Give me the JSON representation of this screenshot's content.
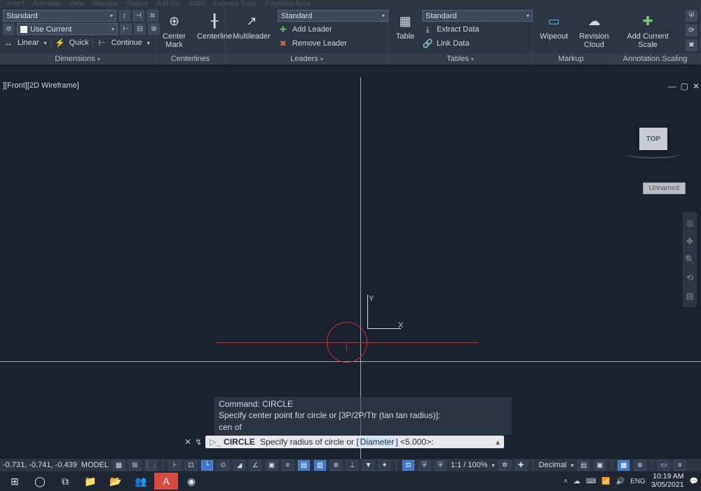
{
  "menu": [
    "Insert",
    "Annotate",
    "View",
    "Manage",
    "Output",
    "Add-Ins",
    "A360",
    "Express Tools",
    "Featured Apps"
  ],
  "ribbon": {
    "dimensions": {
      "panel_label": "Dimensions",
      "style_selected": "Standard",
      "layer_selected": "Use Current",
      "linear_label": "Linear",
      "quick_label": "Quick",
      "continue_label": "Continue"
    },
    "centerlines": {
      "panel_label": "Centerlines",
      "center_mark": "Center Mark",
      "centerline": "Centerline"
    },
    "leaders": {
      "panel_label": "Leaders",
      "style_selected": "Standard",
      "multileader": "Multileader",
      "add_leader": "Add Leader",
      "remove_leader": "Remove Leader"
    },
    "tables": {
      "panel_label": "Tables",
      "style_selected": "Standard",
      "table": "Table",
      "extract": "Extract Data",
      "link": "Link Data"
    },
    "markup": {
      "panel_label": "Markup",
      "wipeout": "Wipeout",
      "revcloud": "Revision Cloud"
    },
    "anno": {
      "panel_label": "Annotation Scaling",
      "add_scale": "Add Current Scale"
    }
  },
  "viewport": {
    "label": "][Front][2D Wireframe]",
    "cube": "TOP",
    "unnamed": "Unnamed"
  },
  "command": {
    "hist1": "Command: CIRCLE",
    "hist2": "Specify center point for circle or [3P/2P/Ttr (tan tan radius)]:",
    "hist3": "cen of",
    "active_cmd": "CIRCLE",
    "prompt_prefix": "Specify radius of circle or [",
    "prompt_option": "Diameter",
    "prompt_suffix": "] <5.000>:"
  },
  "status": {
    "coords": "-0.731, -0.741, -0.439",
    "space": "MODEL",
    "scale": "1:1 / 100%",
    "units": "Decimal"
  },
  "taskbar": {
    "time": "10:19 AM",
    "date": "3/05/2021",
    "lang": "ENG"
  }
}
